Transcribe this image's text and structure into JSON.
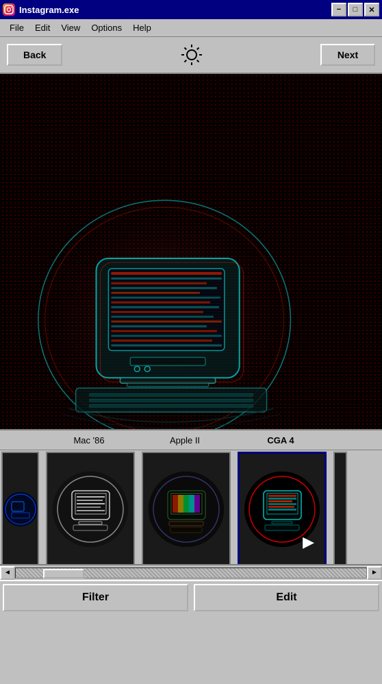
{
  "window": {
    "title": "Instagram.exe",
    "icon": "instagram-icon"
  },
  "title_buttons": [
    {
      "label": "−",
      "name": "minimize-button"
    },
    {
      "label": "□",
      "name": "maximize-button"
    },
    {
      "label": "✕",
      "name": "close-button"
    }
  ],
  "menu": {
    "items": [
      "File",
      "Edit",
      "View",
      "Options",
      "Help"
    ]
  },
  "toolbar": {
    "back_label": "Back",
    "next_label": "Next",
    "sun_icon": "☀"
  },
  "filmstrip": {
    "labels": [
      "Mac '86",
      "Apple II",
      "CGA 4"
    ],
    "items": [
      {
        "name": "filter-item-first",
        "label": ""
      },
      {
        "name": "filter-item-mac86",
        "label": "Mac '86"
      },
      {
        "name": "filter-item-apple2",
        "label": "Apple II"
      },
      {
        "name": "filter-item-cga4",
        "label": "CGA 4",
        "active": true
      },
      {
        "name": "filter-item-next",
        "label": ""
      }
    ]
  },
  "scrollbar": {
    "left_arrow": "◄",
    "right_arrow": "►"
  },
  "bottom_buttons": {
    "filter_label": "Filter",
    "edit_label": "Edit"
  }
}
